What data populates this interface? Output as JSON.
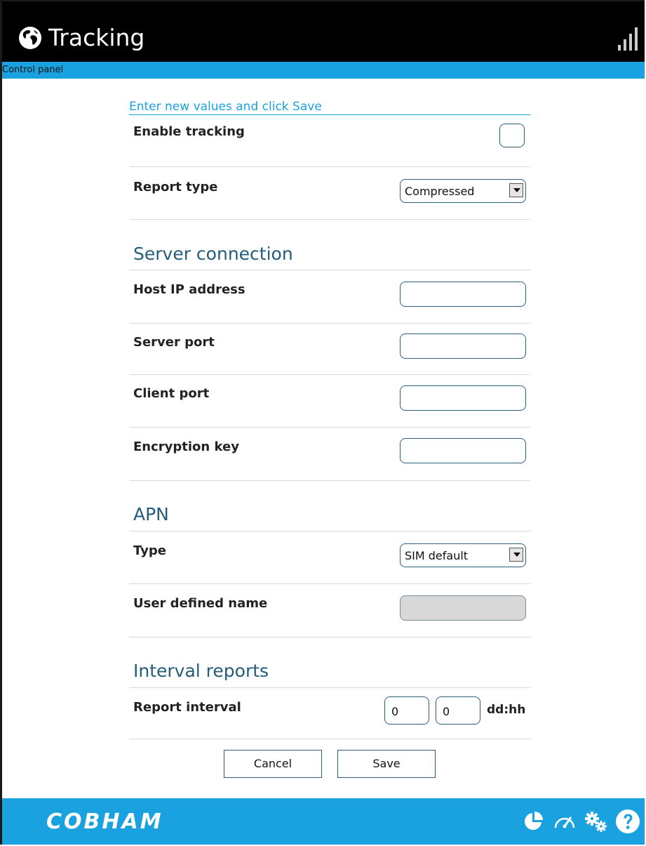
{
  "header": {
    "title": "Tracking",
    "subtitle": "Control panel"
  },
  "form": {
    "instruction": "Enter new values and click Save",
    "enable_tracking": {
      "label": "Enable tracking",
      "checked": false
    },
    "report_type": {
      "label": "Report type",
      "value": "Compressed"
    },
    "server_section": "Server connection",
    "host_ip": {
      "label": "Host IP address",
      "value": ""
    },
    "server_port": {
      "label": "Server port",
      "value": ""
    },
    "client_port": {
      "label": "Client port",
      "value": ""
    },
    "encryption_key": {
      "label": "Encryption key",
      "value": ""
    },
    "apn_section": "APN",
    "apn_type": {
      "label": "Type",
      "value": "SIM default"
    },
    "user_defined_name": {
      "label": "User defined name",
      "value": ""
    },
    "interval_section": "Interval reports",
    "report_interval": {
      "label": "Report interval",
      "days": "0",
      "hours": "0",
      "unit": "dd:hh"
    }
  },
  "buttons": {
    "cancel": "Cancel",
    "save": "Save"
  },
  "footer": {
    "brand": "COBHAM",
    "icons": [
      "pie-chart-icon",
      "speedometer-icon",
      "gears-icon",
      "help-icon"
    ]
  },
  "colors": {
    "accent": "#1aa1e0",
    "header_bg": "#000000",
    "section_title": "#245d7a"
  }
}
